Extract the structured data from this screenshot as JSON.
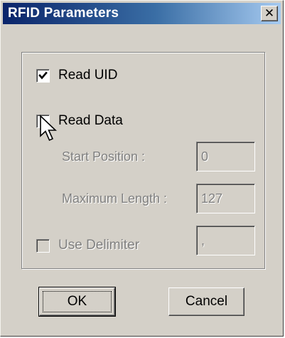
{
  "window": {
    "title": "RFID Parameters"
  },
  "title_bar": {
    "close_icon": "close-x-icon"
  },
  "options": {
    "read_uid": {
      "label": "Read UID",
      "checked": true,
      "enabled": true
    },
    "read_data": {
      "label": "Read Data",
      "checked": false,
      "enabled": true
    },
    "use_delimiter": {
      "label": "Use Delimiter",
      "checked": false,
      "enabled": false
    }
  },
  "fields": {
    "start_position": {
      "label": "Start Position :",
      "value": "0",
      "enabled": false
    },
    "maximum_length": {
      "label": "Maximum Length :",
      "value": "127",
      "enabled": false
    },
    "delimiter": {
      "value": ",",
      "enabled": false
    }
  },
  "buttons": {
    "ok": "OK",
    "cancel": "Cancel"
  },
  "cursor": {
    "icon": "arrow-pointer-icon"
  }
}
